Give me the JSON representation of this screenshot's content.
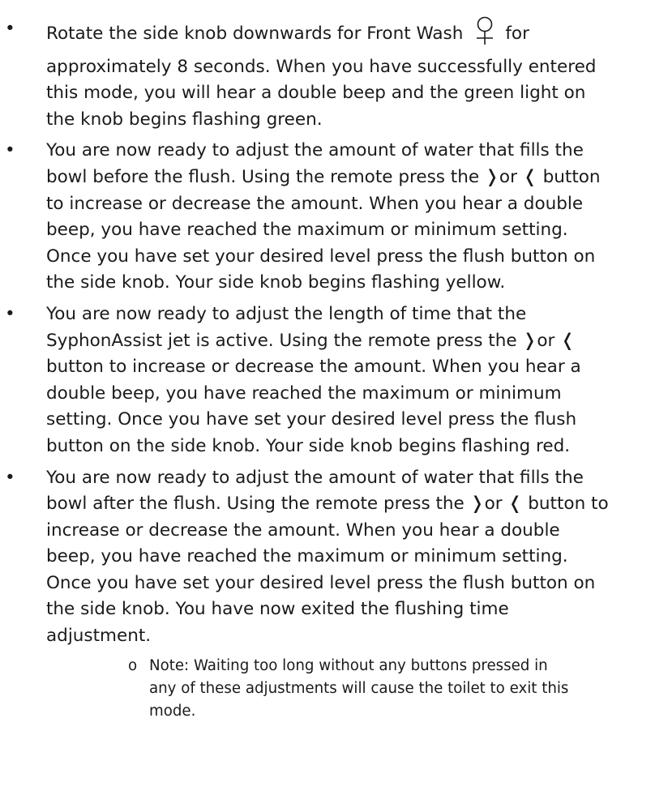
{
  "bullet_marker": "•",
  "items": [
    {
      "lines": [
        null,
        "approximately 8 seconds. When you have successfully entered",
        "this mode, you will hear a double beep and the green light on",
        "the knob begins flashing green."
      ],
      "first_line": {
        "before_icon": "Rotate the side knob downwards for Front Wash",
        "icon": "female-symbol-icon",
        "after_icon": "for"
      }
    },
    {
      "lines": [
        "You are now ready to adjust the amount of water that fills the",
        "bowl before the flush. Using the remote press the ❭or ❬ button",
        "to increase or decrease the amount. When you hear a double",
        "beep, you have reached the maximum or minimum setting.",
        "Once you have set your desired level press the flush button on",
        "the side knob. Your side knob begins flashing yellow."
      ]
    },
    {
      "lines": [
        "You are now ready to adjust the length of time that the",
        "SyphonAssist jet is active. Using the remote press the ❭or ❬",
        "button to increase or decrease the amount. When you hear a",
        "double beep, you have reached the maximum or minimum",
        "setting. Once you have set your desired level press the flush",
        "button on the side knob. Your side knob begins flashing red."
      ]
    },
    {
      "lines": [
        "You are now ready to adjust the amount of water that fills the",
        "bowl after the flush. Using the remote press the ❭or ❬ button to",
        "increase or decrease the amount. When you hear a double",
        "beep, you have reached the maximum or minimum setting.",
        "Once you have set your desired level press the flush button on",
        "the side knob. You have now exited the flushing time",
        "adjustment."
      ]
    }
  ],
  "note": {
    "marker": "o",
    "lines": [
      "Note: Waiting too long without any buttons pressed in",
      "any of these adjustments will cause the toilet to exit this",
      "mode."
    ]
  }
}
